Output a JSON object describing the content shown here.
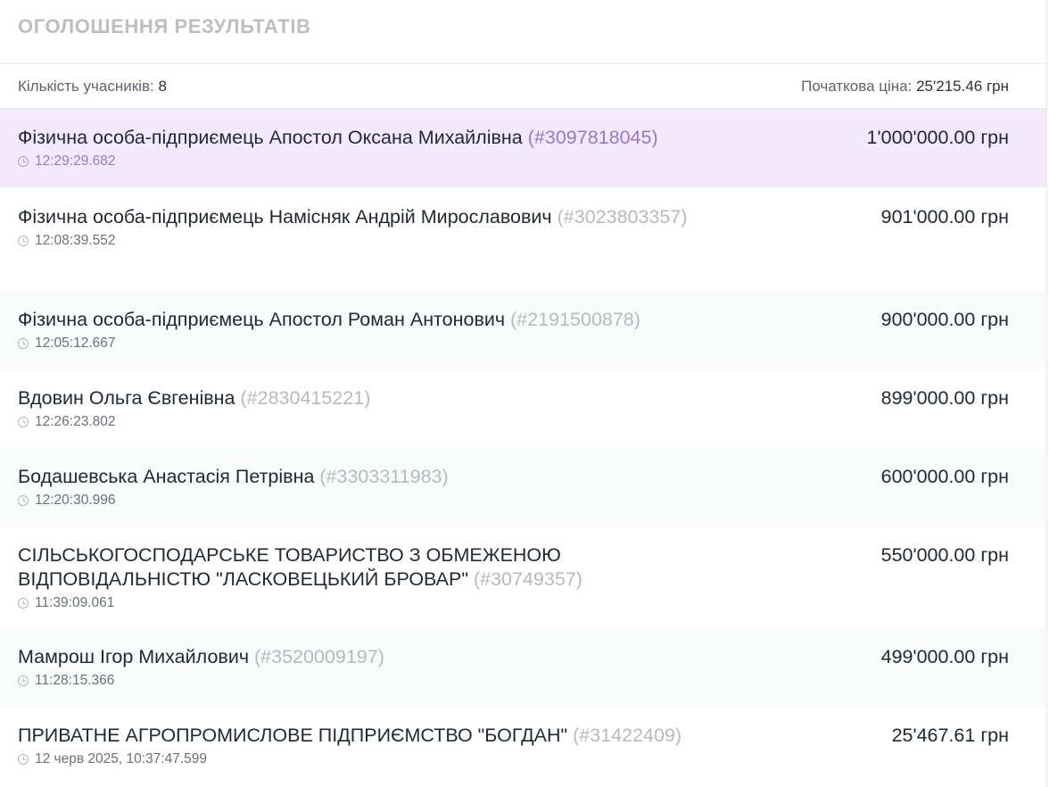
{
  "header": {
    "title": "ОГОЛОШЕННЯ РЕЗУЛЬТАТІВ"
  },
  "summary": {
    "participants_label": "Кількість учасників:",
    "participants_value": "8",
    "start_price_label": "Початкова ціна:",
    "start_price_value": "25'215.46 грн"
  },
  "bids": [
    {
      "name": "Фізична особа-підприємець Апостол Оксана Михайлівна",
      "id": "(#3097818045)",
      "time": "12:29:29.682",
      "amount": "1'000'000.00 грн",
      "winner": true
    },
    {
      "name": "Фізична особа-підприємець Намісняк Андрій Мирославович",
      "id": "(#3023803357)",
      "time": "12:08:39.552",
      "amount": "901'000.00 грн",
      "winner": false
    },
    {
      "name": "Фізична особа-підприємець Апостол Роман Антонович",
      "id": "(#2191500878)",
      "time": "12:05:12.667",
      "amount": "900'000.00 грн",
      "winner": false
    },
    {
      "name": "Вдовин Ольга Євгенівна",
      "id": "(#2830415221)",
      "time": "12:26:23.802",
      "amount": "899'000.00 грн",
      "winner": false
    },
    {
      "name": "Бодашевська Анастасія Петрівна",
      "id": "(#3303311983)",
      "time": "12:20:30.996",
      "amount": "600'000.00 грн",
      "winner": false
    },
    {
      "name": "СІЛЬСЬКОГОСПОДАРСЬКЕ ТОВАРИСТВО З ОБМЕЖЕНОЮ ВІДПОВІДАЛЬНІСТЮ \"ЛАСКОВЕЦЬКИЙ БРОВАР\"",
      "id": "(#30749357)",
      "time": "11:39:09.061",
      "amount": "550'000.00 грн",
      "winner": false
    },
    {
      "name": "Мамрош Ігор Михайлович",
      "id": "(#3520009197)",
      "time": "11:28:15.366",
      "amount": "499'000.00 грн",
      "winner": false
    },
    {
      "name": "ПРИВАТНЕ АГРОПРОМИСЛОВЕ ПІДПРИЄМСТВО \"БОГДАН\"",
      "id": "(#31422409)",
      "time": "12 черв 2025, 10:37:47.599",
      "amount": "25'467.61 грн",
      "winner": false
    }
  ],
  "colors": {
    "winner_bg": "#f2e9fd",
    "winner_accent": "#9b76cf",
    "title_gray": "#bdbdc2"
  }
}
